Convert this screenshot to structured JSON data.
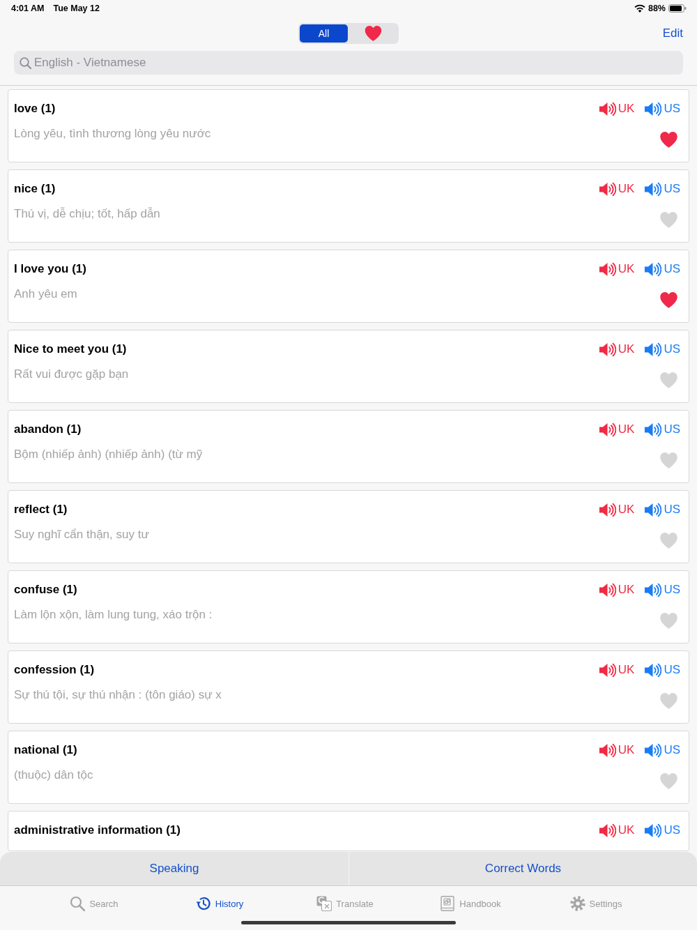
{
  "status_bar": {
    "time": "4:01 AM",
    "date": "Tue May 12",
    "battery": "88%"
  },
  "header": {
    "segments": [
      {
        "kind": "text",
        "label": "All",
        "selected": true
      },
      {
        "kind": "icon",
        "selected": false
      }
    ],
    "edit": "Edit"
  },
  "search": {
    "placeholder": "English - Vietnamese"
  },
  "words": [
    {
      "title": "love (1)",
      "meaning": "Lòng yêu, tình thương lòng yêu nước",
      "favorite": true,
      "audio": [
        {
          "label": "UK",
          "color": "#ef2b45"
        },
        {
          "label": "US",
          "color": "#1a7cf5"
        }
      ]
    },
    {
      "title": "nice (1)",
      "meaning": "Thú vị, dễ chịu; tốt, hấp dẫn",
      "favorite": false,
      "audio": [
        {
          "label": "UK",
          "color": "#ef2b45"
        },
        {
          "label": "US",
          "color": "#1a7cf5"
        }
      ]
    },
    {
      "title": "I love you (1)",
      "meaning": "Anh yêu em",
      "favorite": true,
      "audio": [
        {
          "label": "UK",
          "color": "#ef2b45"
        },
        {
          "label": "US",
          "color": "#1a7cf5"
        }
      ]
    },
    {
      "title": "Nice to meet you (1)",
      "meaning": "Rất vui được gặp bạn",
      "favorite": false,
      "audio": [
        {
          "label": "UK",
          "color": "#ef2b45"
        },
        {
          "label": "US",
          "color": "#1a7cf5"
        }
      ]
    },
    {
      "title": "abandon (1)",
      "meaning": "Bộm (nhiếp ảnh) (nhiếp ảnh) (từ mỹ",
      "favorite": false,
      "audio": [
        {
          "label": "UK",
          "color": "#ef2b45"
        },
        {
          "label": "US",
          "color": "#1a7cf5"
        }
      ]
    },
    {
      "title": "reflect (1)",
      "meaning": "Suy nghĩ cẩn thận, suy tư",
      "favorite": false,
      "audio": [
        {
          "label": "UK",
          "color": "#ef2b45"
        },
        {
          "label": "US",
          "color": "#1a7cf5"
        }
      ]
    },
    {
      "title": "confuse (1)",
      "meaning": "Làm lộn xộn, làm lung tung, xáo trộn :",
      "favorite": false,
      "audio": [
        {
          "label": "UK",
          "color": "#ef2b45"
        },
        {
          "label": "US",
          "color": "#1a7cf5"
        }
      ]
    },
    {
      "title": "confession (1)",
      "meaning": "Sự thú tội, sự thú nhận : (tôn giáo) sự x",
      "favorite": false,
      "audio": [
        {
          "label": "UK",
          "color": "#ef2b45"
        },
        {
          "label": "US",
          "color": "#1a7cf5"
        }
      ]
    },
    {
      "title": "national (1)",
      "meaning": "(thuộc) dân tộc",
      "favorite": false,
      "audio": [
        {
          "label": "UK",
          "color": "#ef2b45"
        },
        {
          "label": "US",
          "color": "#1a7cf5"
        }
      ]
    },
    {
      "title": "administrative information (1)",
      "audio": [
        {
          "label": "UK",
          "color": "#ef2b45"
        },
        {
          "label": "US",
          "color": "#1a7cf5"
        }
      ]
    }
  ],
  "actions": [
    "Speaking",
    "Correct Words"
  ],
  "tab_bar": [
    {
      "label": "Search",
      "selected": false
    },
    {
      "label": "History",
      "selected": true
    },
    {
      "label": "Translate",
      "selected": false
    },
    {
      "label": "Handbook",
      "selected": false
    },
    {
      "label": "Settings",
      "selected": false
    }
  ]
}
